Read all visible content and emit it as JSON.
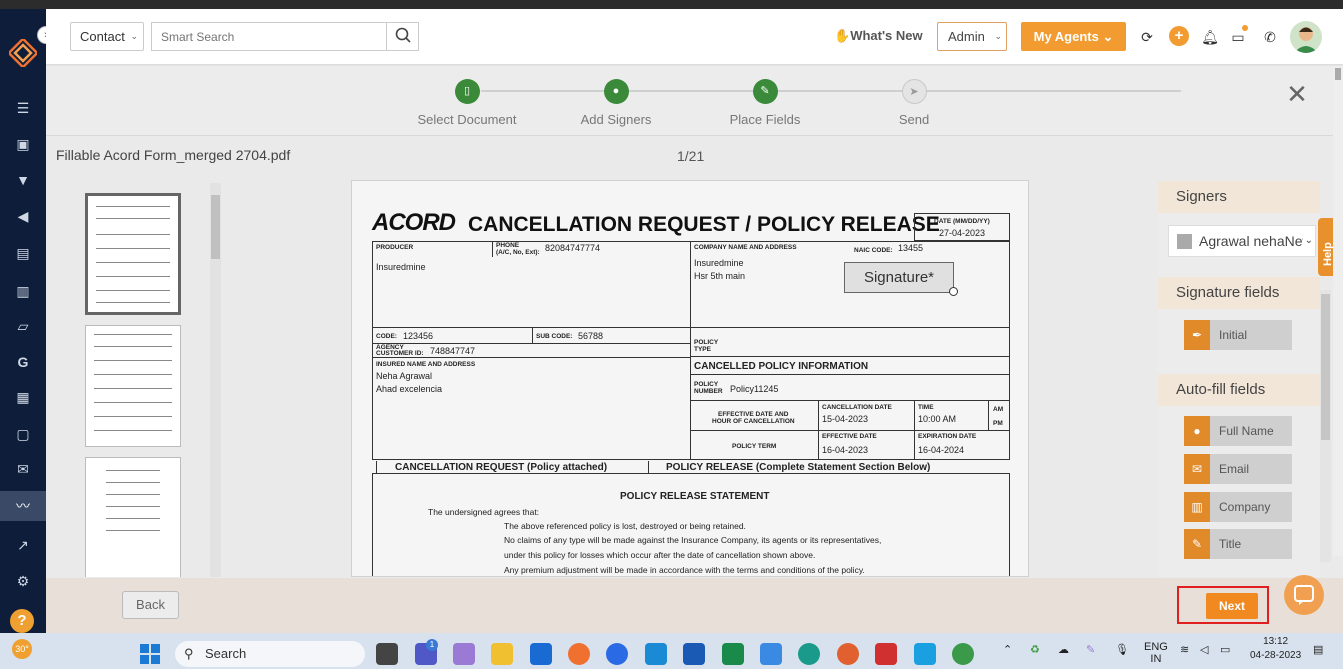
{
  "header": {
    "contact_select": "Contact",
    "search_placeholder": "Smart Search",
    "whats_new": "What's New",
    "admin_select": "Admin",
    "my_agents": "My Agents"
  },
  "steps": [
    {
      "label": "Select Document",
      "status": "done"
    },
    {
      "label": "Add Signers",
      "status": "done"
    },
    {
      "label": "Place Fields",
      "status": "done"
    },
    {
      "label": "Send",
      "status": "pending"
    }
  ],
  "document": {
    "filename": "Fillable Acord Form_merged 2704.pdf",
    "page_indicator": "1/21",
    "logo": "ACORD",
    "title": "CANCELLATION REQUEST / POLICY RELEASE",
    "date_label": "DATE (MM/DD/YY)",
    "date_value": "27-04-2023",
    "producer_label": "PRODUCER",
    "phone_label": "PHONE",
    "phone_sub": "(A/C, No, Ext):",
    "phone_value": "82084747774",
    "producer_value": "Insuredmine",
    "company_label": "COMPANY NAME AND ADDRESS",
    "naic_label": "NAIC CODE:",
    "naic_value": "13455",
    "company_line1": "Insuredmine",
    "company_line2": "Hsr 5th main",
    "code_label": "CODE:",
    "code_value": "123456",
    "subcode_label": "SUB CODE:",
    "subcode_value": "56788",
    "agency_label": "AGENCY",
    "customer_id_label": "CUSTOMER ID:",
    "customer_id_value": "748847747",
    "policy_type_label1": "POLICY",
    "policy_type_label2": "TYPE",
    "insured_label": "INSURED NAME AND ADDRESS",
    "insured_line1": "Neha Agrawal",
    "insured_line2": "Ahad excelencia",
    "cancelled_header": "CANCELLED POLICY INFORMATION",
    "policy_number_label1": "POLICY",
    "policy_number_label2": "NUMBER",
    "policy_number_value": "Policy11245",
    "effective_label1": "EFFECTIVE DATE AND",
    "effective_label2": "HOUR OF CANCELLATION",
    "cancellation_date_label": "CANCELLATION DATE",
    "cancellation_date_value": "15-04-2023",
    "time_label": "TIME",
    "time_value": "10:00 AM",
    "am": "AM",
    "pm": "PM",
    "policy_term_label": "POLICY TERM",
    "effective_date_label": "EFFECTIVE DATE",
    "effective_date_value": "16-04-2023",
    "expiration_label": "EXPIRATION DATE",
    "expiration_value": "16-04-2024",
    "cancel_request_option": "CANCELLATION REQUEST (Policy attached)",
    "release_option": "POLICY RELEASE (Complete Statement Section Below)",
    "statement_title": "POLICY RELEASE STATEMENT",
    "statement_intro": "The undersigned agrees that:",
    "statement_lines": [
      "The above referenced policy is lost, destroyed or being retained.",
      "No claims of any type will be made against the Insurance Company, its agents or its representatives,",
      "under this policy for losses which occur after the date of cancellation shown above.",
      "Any premium adjustment will be made in accordance with the terms and conditions of the policy."
    ],
    "signature_field": "Signature*"
  },
  "right_panel": {
    "signers_heading": "Signers",
    "signer_selected": "Agrawal nehaNew",
    "signature_fields_heading": "Signature fields",
    "signature_fields": [
      {
        "label": "Initial",
        "icon": "pen-icon"
      }
    ],
    "autofill_heading": "Auto-fill fields",
    "autofill_fields": [
      {
        "label": "Full Name",
        "icon": "person-icon"
      },
      {
        "label": "Email Address",
        "icon": "envelope-icon"
      },
      {
        "label": "Company",
        "icon": "building-icon"
      },
      {
        "label": "Title",
        "icon": "pencil-icon"
      }
    ],
    "help_tab": "Help"
  },
  "footer": {
    "back": "Back",
    "next": "Next"
  },
  "taskbar": {
    "weather": "30°",
    "search": "Search",
    "lang1": "ENG",
    "lang2": "IN",
    "time": "13:12",
    "date": "04-28-2023",
    "badge": "1"
  },
  "colors": {
    "accent": "#f29b30",
    "step_done": "#3a8a3a",
    "nav_bg": "#0d1d3a",
    "highlight": "#e02020"
  }
}
